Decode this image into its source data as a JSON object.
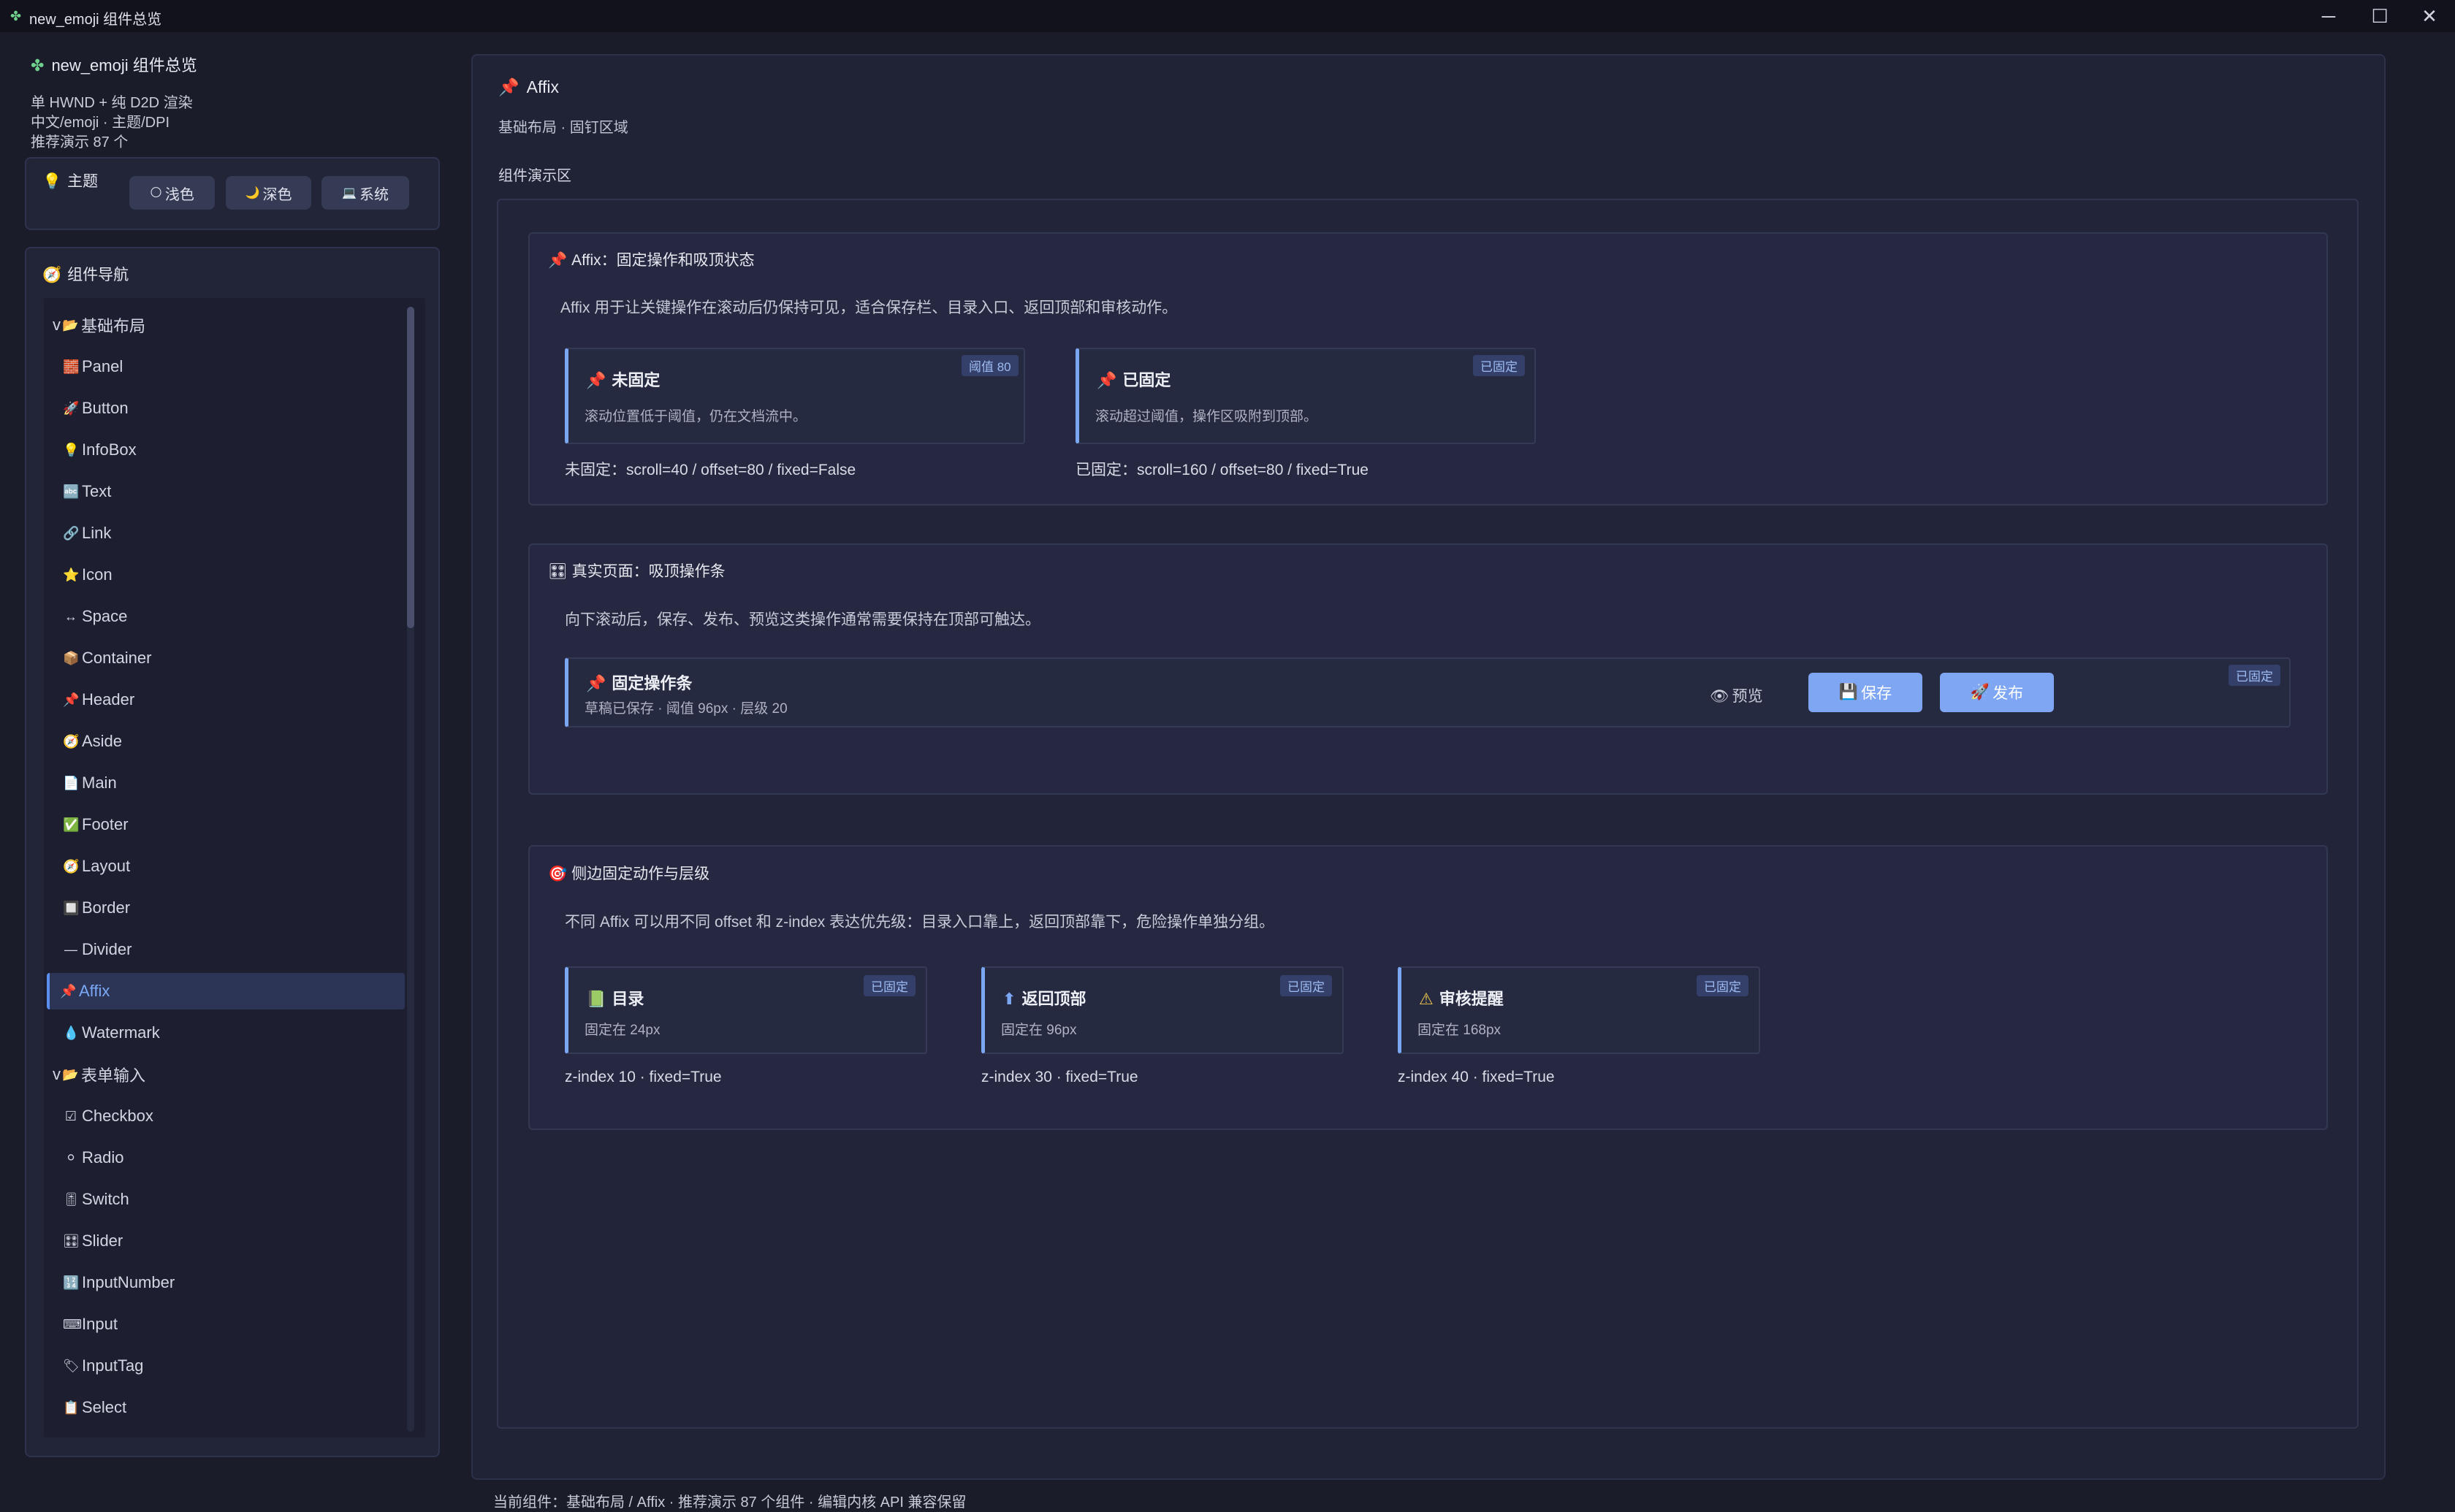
{
  "window": {
    "title": "new_emoji 组件总览",
    "controls": [
      "─",
      "☐",
      "✕"
    ]
  },
  "sidebar": {
    "title": "new_emoji 组件总览",
    "desc": [
      "单 HWND + 纯 D2D 渲染",
      "中文/emoji · 主题/DPI",
      "推荐演示 87 个"
    ],
    "theme": {
      "label": "主题",
      "buttons": [
        {
          "icon": "🌕",
          "label": "浅色"
        },
        {
          "icon": "🌙",
          "label": "深色"
        },
        {
          "icon": "💻",
          "label": "系统"
        }
      ]
    },
    "nav": {
      "label": "组件导航",
      "items": [
        {
          "icon": "📂",
          "label": "基础布局",
          "group": true,
          "prefix": "v"
        },
        {
          "icon": "🧱",
          "label": "Panel"
        },
        {
          "icon": "🚀",
          "label": "Button"
        },
        {
          "icon": "💡",
          "label": "InfoBox"
        },
        {
          "icon": "🔤",
          "label": "Text"
        },
        {
          "icon": "🔗",
          "label": "Link"
        },
        {
          "icon": "⭐",
          "label": "Icon"
        },
        {
          "icon": "↔",
          "label": "Space"
        },
        {
          "icon": "📦",
          "label": "Container"
        },
        {
          "icon": "📌",
          "label": "Header"
        },
        {
          "icon": "🧭",
          "label": "Aside"
        },
        {
          "icon": "📄",
          "label": "Main"
        },
        {
          "icon": "✅",
          "label": "Footer"
        },
        {
          "icon": "🧭",
          "label": "Layout"
        },
        {
          "icon": "🔲",
          "label": "Border"
        },
        {
          "icon": "—",
          "label": "Divider"
        },
        {
          "icon": "📌",
          "label": "Affix",
          "active": true
        },
        {
          "icon": "💧",
          "label": "Watermark"
        },
        {
          "icon": "📂",
          "label": "表单输入",
          "group": true,
          "prefix": "v"
        },
        {
          "icon": "☑",
          "label": "Checkbox"
        },
        {
          "icon": "⚪",
          "label": "Radio"
        },
        {
          "icon": "🎚",
          "label": "Switch"
        },
        {
          "icon": "🎛",
          "label": "Slider"
        },
        {
          "icon": "🔢",
          "label": "InputNumber"
        },
        {
          "icon": "⌨",
          "label": "Input"
        },
        {
          "icon": "🏷",
          "label": "InputTag"
        },
        {
          "icon": "📋",
          "label": "Select"
        }
      ]
    }
  },
  "main": {
    "title": "Affix",
    "subtitle": "基础布局 · 固钉区域",
    "demo_label": "组件演示区",
    "sections": {
      "s1": {
        "title": "Affix：固定操作和吸顶状态",
        "desc": "Affix 用于让关键操作在滚动后仍保持可见，适合保存栏、目录入口、返回顶部和审核动作。",
        "cards": [
          {
            "title": "未固定",
            "desc": "滚动位置低于阈值，仍在文档流中。",
            "badge": "阈值 80",
            "foot": "未固定：scroll=40 / offset=80 / fixed=False"
          },
          {
            "title": "已固定",
            "desc": "滚动超过阈值，操作区吸附到顶部。",
            "badge": "已固定",
            "foot": "已固定：scroll=160 / offset=80 / fixed=True"
          }
        ]
      },
      "s2": {
        "title": "真实页面：吸顶操作条",
        "desc": "向下滚动后，保存、发布、预览这类操作通常需要保持在顶部可触达。",
        "bar": {
          "title": "固定操作条",
          "desc": "草稿已保存 · 阈值 96px · 层级 20",
          "preview": "预览",
          "save": "保存",
          "publish": "发布",
          "badge": "已固定"
        }
      },
      "s3": {
        "title": "侧边固定动作与层级",
        "desc": "不同 Affix 可以用不同 offset 和 z-index 表达优先级：目录入口靠上，返回顶部靠下，危险操作单独分组。",
        "cards": [
          {
            "icon": "📗",
            "title": "目录",
            "desc": "固定在 24px",
            "badge": "已固定",
            "foot": "z-index 10 · fixed=True"
          },
          {
            "icon": "⬆",
            "title": "返回顶部",
            "desc": "固定在 96px",
            "badge": "已固定",
            "foot": "z-index 30 · fixed=True"
          },
          {
            "icon": "⚠",
            "title": "审核提醒",
            "desc": "固定在 168px",
            "badge": "已固定",
            "foot": "z-index 40 · fixed=True"
          }
        ]
      }
    }
  },
  "status": "当前组件：基础布局 / Affix · 推荐演示 87 个组件 · 编辑内核 API 兼容保留",
  "colors": {
    "accent": "#7aa6f2",
    "background": "#1a1c2a",
    "panel": "#222538"
  }
}
